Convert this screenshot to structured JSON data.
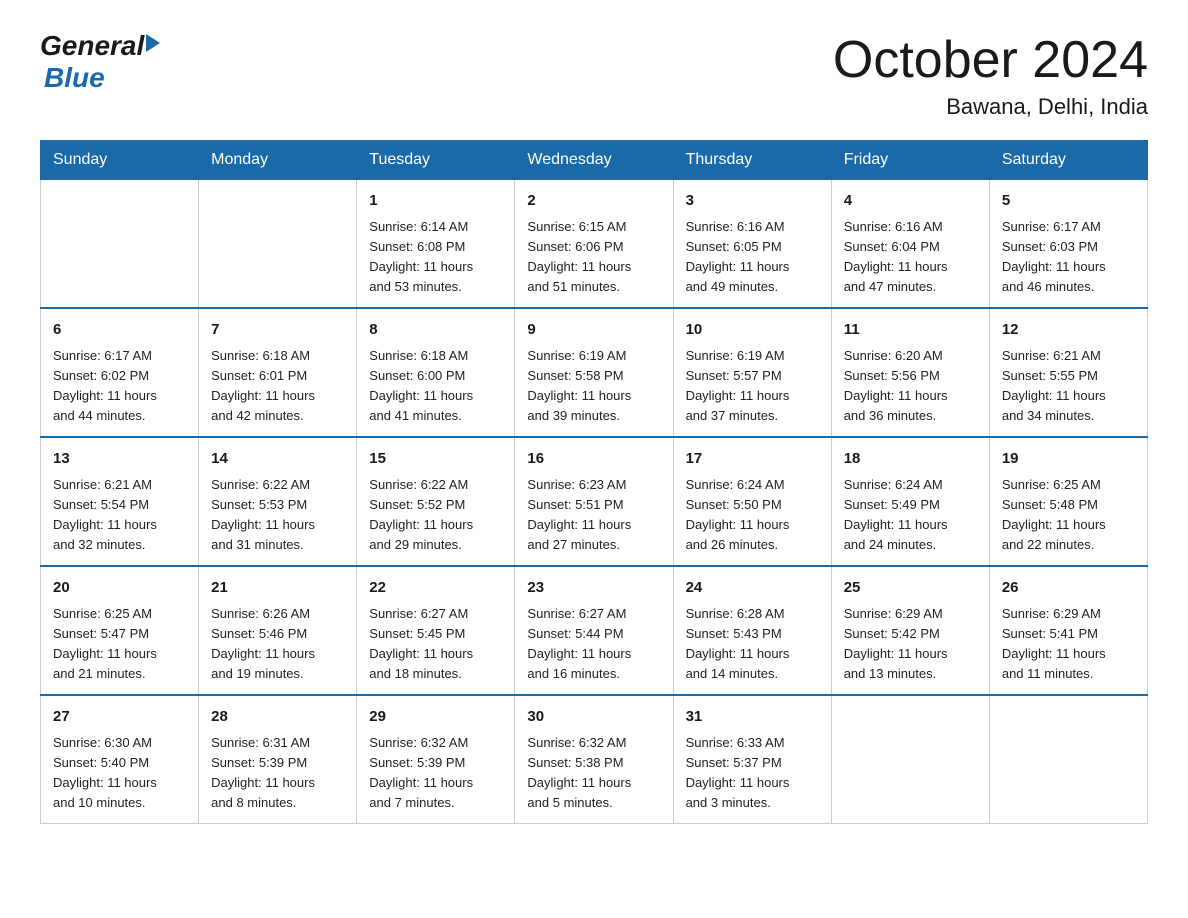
{
  "logo": {
    "general": "General",
    "blue": "Blue"
  },
  "title": {
    "month_year": "October 2024",
    "location": "Bawana, Delhi, India"
  },
  "weekdays": [
    "Sunday",
    "Monday",
    "Tuesday",
    "Wednesday",
    "Thursday",
    "Friday",
    "Saturday"
  ],
  "weeks": [
    [
      {
        "day": "",
        "info": ""
      },
      {
        "day": "",
        "info": ""
      },
      {
        "day": "1",
        "info": "Sunrise: 6:14 AM\nSunset: 6:08 PM\nDaylight: 11 hours\nand 53 minutes."
      },
      {
        "day": "2",
        "info": "Sunrise: 6:15 AM\nSunset: 6:06 PM\nDaylight: 11 hours\nand 51 minutes."
      },
      {
        "day": "3",
        "info": "Sunrise: 6:16 AM\nSunset: 6:05 PM\nDaylight: 11 hours\nand 49 minutes."
      },
      {
        "day": "4",
        "info": "Sunrise: 6:16 AM\nSunset: 6:04 PM\nDaylight: 11 hours\nand 47 minutes."
      },
      {
        "day": "5",
        "info": "Sunrise: 6:17 AM\nSunset: 6:03 PM\nDaylight: 11 hours\nand 46 minutes."
      }
    ],
    [
      {
        "day": "6",
        "info": "Sunrise: 6:17 AM\nSunset: 6:02 PM\nDaylight: 11 hours\nand 44 minutes."
      },
      {
        "day": "7",
        "info": "Sunrise: 6:18 AM\nSunset: 6:01 PM\nDaylight: 11 hours\nand 42 minutes."
      },
      {
        "day": "8",
        "info": "Sunrise: 6:18 AM\nSunset: 6:00 PM\nDaylight: 11 hours\nand 41 minutes."
      },
      {
        "day": "9",
        "info": "Sunrise: 6:19 AM\nSunset: 5:58 PM\nDaylight: 11 hours\nand 39 minutes."
      },
      {
        "day": "10",
        "info": "Sunrise: 6:19 AM\nSunset: 5:57 PM\nDaylight: 11 hours\nand 37 minutes."
      },
      {
        "day": "11",
        "info": "Sunrise: 6:20 AM\nSunset: 5:56 PM\nDaylight: 11 hours\nand 36 minutes."
      },
      {
        "day": "12",
        "info": "Sunrise: 6:21 AM\nSunset: 5:55 PM\nDaylight: 11 hours\nand 34 minutes."
      }
    ],
    [
      {
        "day": "13",
        "info": "Sunrise: 6:21 AM\nSunset: 5:54 PM\nDaylight: 11 hours\nand 32 minutes."
      },
      {
        "day": "14",
        "info": "Sunrise: 6:22 AM\nSunset: 5:53 PM\nDaylight: 11 hours\nand 31 minutes."
      },
      {
        "day": "15",
        "info": "Sunrise: 6:22 AM\nSunset: 5:52 PM\nDaylight: 11 hours\nand 29 minutes."
      },
      {
        "day": "16",
        "info": "Sunrise: 6:23 AM\nSunset: 5:51 PM\nDaylight: 11 hours\nand 27 minutes."
      },
      {
        "day": "17",
        "info": "Sunrise: 6:24 AM\nSunset: 5:50 PM\nDaylight: 11 hours\nand 26 minutes."
      },
      {
        "day": "18",
        "info": "Sunrise: 6:24 AM\nSunset: 5:49 PM\nDaylight: 11 hours\nand 24 minutes."
      },
      {
        "day": "19",
        "info": "Sunrise: 6:25 AM\nSunset: 5:48 PM\nDaylight: 11 hours\nand 22 minutes."
      }
    ],
    [
      {
        "day": "20",
        "info": "Sunrise: 6:25 AM\nSunset: 5:47 PM\nDaylight: 11 hours\nand 21 minutes."
      },
      {
        "day": "21",
        "info": "Sunrise: 6:26 AM\nSunset: 5:46 PM\nDaylight: 11 hours\nand 19 minutes."
      },
      {
        "day": "22",
        "info": "Sunrise: 6:27 AM\nSunset: 5:45 PM\nDaylight: 11 hours\nand 18 minutes."
      },
      {
        "day": "23",
        "info": "Sunrise: 6:27 AM\nSunset: 5:44 PM\nDaylight: 11 hours\nand 16 minutes."
      },
      {
        "day": "24",
        "info": "Sunrise: 6:28 AM\nSunset: 5:43 PM\nDaylight: 11 hours\nand 14 minutes."
      },
      {
        "day": "25",
        "info": "Sunrise: 6:29 AM\nSunset: 5:42 PM\nDaylight: 11 hours\nand 13 minutes."
      },
      {
        "day": "26",
        "info": "Sunrise: 6:29 AM\nSunset: 5:41 PM\nDaylight: 11 hours\nand 11 minutes."
      }
    ],
    [
      {
        "day": "27",
        "info": "Sunrise: 6:30 AM\nSunset: 5:40 PM\nDaylight: 11 hours\nand 10 minutes."
      },
      {
        "day": "28",
        "info": "Sunrise: 6:31 AM\nSunset: 5:39 PM\nDaylight: 11 hours\nand 8 minutes."
      },
      {
        "day": "29",
        "info": "Sunrise: 6:32 AM\nSunset: 5:39 PM\nDaylight: 11 hours\nand 7 minutes."
      },
      {
        "day": "30",
        "info": "Sunrise: 6:32 AM\nSunset: 5:38 PM\nDaylight: 11 hours\nand 5 minutes."
      },
      {
        "day": "31",
        "info": "Sunrise: 6:33 AM\nSunset: 5:37 PM\nDaylight: 11 hours\nand 3 minutes."
      },
      {
        "day": "",
        "info": ""
      },
      {
        "day": "",
        "info": ""
      }
    ]
  ]
}
